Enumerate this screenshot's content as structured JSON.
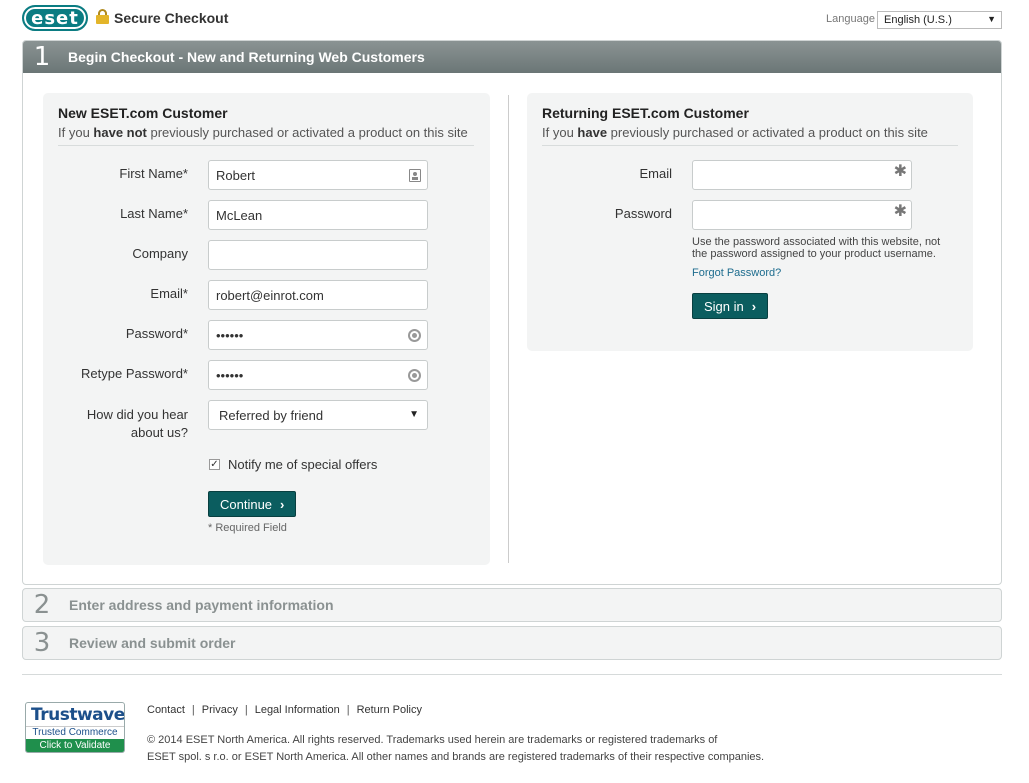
{
  "header": {
    "logo": "eset",
    "title": "Secure Checkout",
    "language_label": "Language",
    "language_value": "English (U.S.)"
  },
  "step1": {
    "number": "1",
    "title": "Begin Checkout - New and Returning Web Customers",
    "new_customer": {
      "title": "New ESET.com Customer",
      "sub_prefix": "If you ",
      "sub_bold": "have not",
      "sub_suffix": " previously purchased or activated a product on this site",
      "fields": {
        "first_name_label": "First Name*",
        "first_name_value": "Robert",
        "last_name_label": "Last Name*",
        "last_name_value": "McLean",
        "company_label": "Company",
        "company_value": "",
        "email_label": "Email*",
        "email_value": "robert@einrot.com",
        "password_label": "Password*",
        "password_value": "••••••",
        "retype_label": "Retype Password*",
        "retype_value": "••••••",
        "hear_label_1": "How did you hear",
        "hear_label_2": "about us?",
        "hear_value": "Referred by friend"
      },
      "notify_label": "Notify me of special offers",
      "notify_checked": true,
      "continue_label": "Continue",
      "required_note": "* Required Field"
    },
    "returning_customer": {
      "title": "Returning ESET.com Customer",
      "sub_prefix": "If you ",
      "sub_bold": "have",
      "sub_suffix": " previously purchased or activated a product on this site",
      "email_label": "Email",
      "email_value": "",
      "password_label": "Password",
      "password_value": "",
      "help_text": "Use the password associated with this website, not the password assigned to your product username.",
      "forgot_label": "Forgot Password?",
      "signin_label": "Sign in"
    }
  },
  "step2": {
    "number": "2",
    "title": "Enter address and payment information"
  },
  "step3": {
    "number": "3",
    "title": "Review and submit order"
  },
  "footer": {
    "trustwave_name": "Trustwave",
    "trustwave_sub": "Trusted Commerce",
    "trustwave_cta": "Click to Validate",
    "links": [
      "Contact",
      "Privacy",
      "Legal Information",
      "Return Policy"
    ],
    "copyright_1": "© 2014 ESET North America. All rights reserved. Trademarks used herein are trademarks or registered trademarks of",
    "copyright_2": "ESET spol. s r.o. or ESET North America. All other names and brands are registered trademarks of their respective companies."
  }
}
